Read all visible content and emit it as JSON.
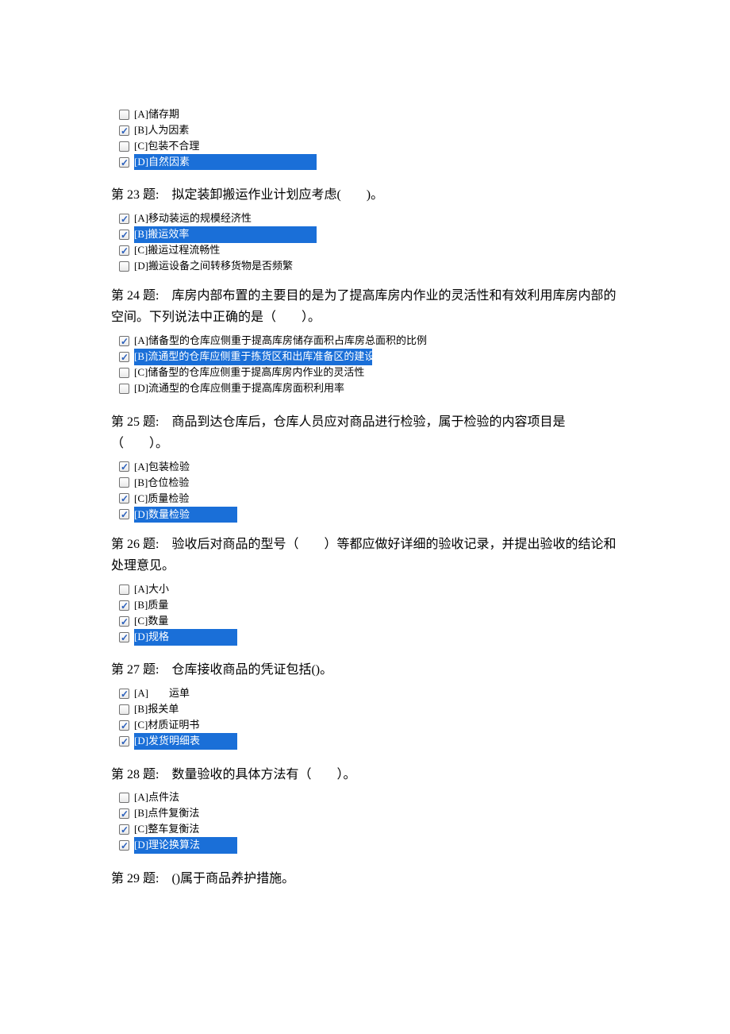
{
  "q22_options": {
    "a": "[A]储存期",
    "b": "[B]人为因素",
    "c": "[C]包装不合理",
    "d": "[D]自然因素"
  },
  "q23": {
    "text": "第 23 题: 拟定装卸搬运作业计划应考虑(  )。",
    "a": "[A]移动装运的规模经济性",
    "b": "[B]搬运效率",
    "c": "[C]搬运过程流畅性",
    "d": "[D]搬运设备之间转移货物是否频繁"
  },
  "q24": {
    "text": "第 24 题: 库房内部布置的主要目的是为了提高库房内作业的灵活性和有效利用库房内部的空间。下列说法中正确的是（  ）。",
    "a": "[A]储备型的仓库应侧重于提高库房储存面积占库房总面积的比例",
    "b": "[B]流通型的仓库应侧重于拣货区和出库准备区的建设",
    "c": "[C]储备型的仓库应侧重于提高库房内作业的灵活性",
    "d": "[D]流通型的仓库应侧重于提高库房面积利用率"
  },
  "q25": {
    "text": "第 25 题: 商品到达仓库后，仓库人员应对商品进行检验，属于检验的内容项目是（  ）。",
    "a": "[A]包装检验",
    "b": "[B]仓位检验",
    "c": "[C]质量检验",
    "d": "[D]数量检验"
  },
  "q26": {
    "text": "第 26 题: 验收后对商品的型号（  ）等都应做好详细的验收记录，并提出验收的结论和处理意见。",
    "a": "[A]大小",
    "b": "[B]质量",
    "c": "[C]数量",
    "d": "[D]规格"
  },
  "q27": {
    "text": "第 27 题: 仓库接收商品的凭证包括()。",
    "a": "[A]  运单",
    "b": "[B]报关单",
    "c": "[C]材质证明书",
    "d": "[D]发货明细表"
  },
  "q28": {
    "text": "第 28 题: 数量验收的具体方法有（  ）。",
    "a": "[A]点件法",
    "b": "[B]点件复衡法",
    "c": "[C]整车复衡法",
    "d": "[D]理论换算法"
  },
  "q29": {
    "text": "第 29 题: ()属于商品养护措施。"
  }
}
